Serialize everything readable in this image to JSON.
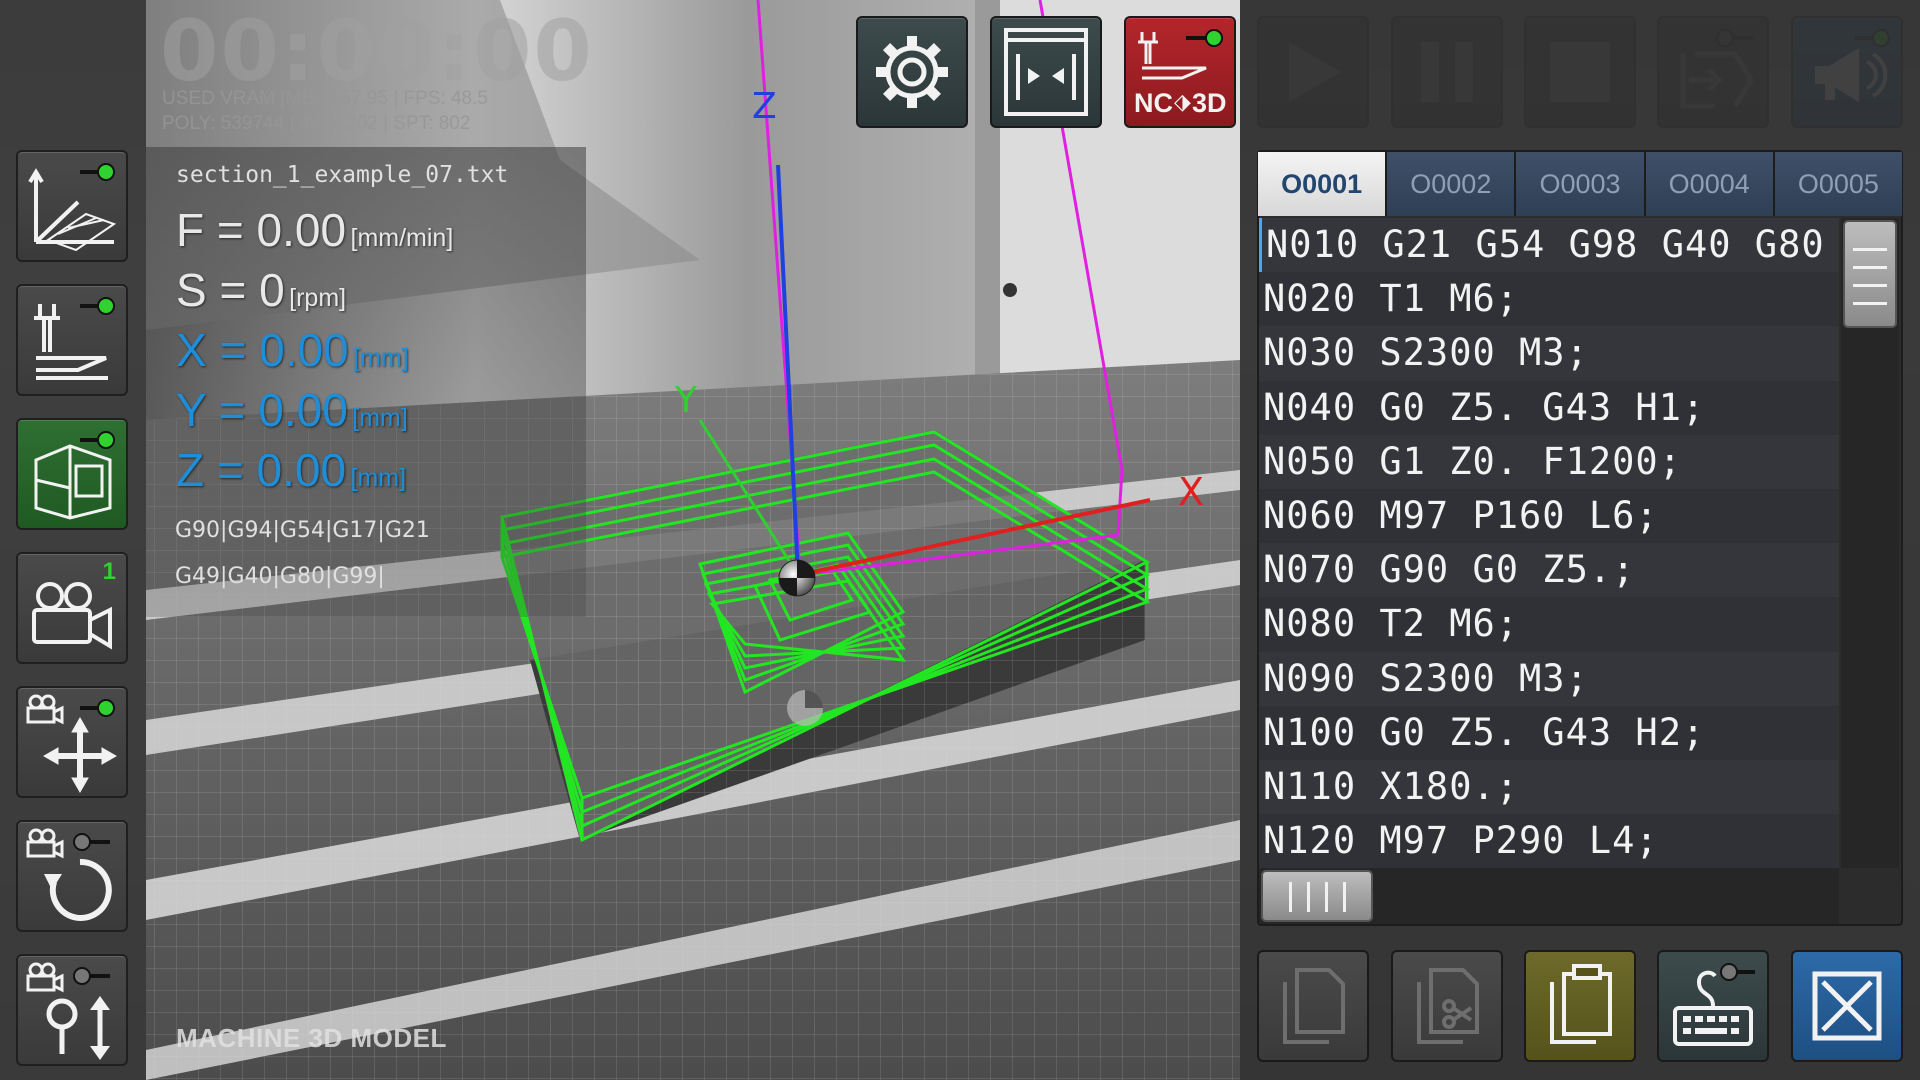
{
  "app": {
    "timer": "00:00:00",
    "stats_line1": "USED VRAM [MB]: 157.95 | FPS: 48.5",
    "stats_line2": "POLY: 539744 | IMG: 202 | SPT: 802"
  },
  "left_toolbar": {
    "items": [
      {
        "icon": "graph-grid-icon",
        "toggle": "on"
      },
      {
        "icon": "toolpath-icon",
        "toggle": "on"
      },
      {
        "icon": "machine-model-icon",
        "toggle": "on",
        "active": true
      },
      {
        "icon": "camera-icon",
        "badge": "1"
      },
      {
        "icon": "camera-pan-icon",
        "toggle": "on"
      },
      {
        "icon": "camera-rotate-icon",
        "toggle": "off"
      },
      {
        "icon": "camera-zoom-icon",
        "toggle": "off"
      }
    ]
  },
  "top_toolbar": {
    "settings_icon": "gear-icon",
    "split_icon": "split-view-icon",
    "nc3d_label": "NC",
    "nc3d_label2": "3D",
    "play_icon": "play-icon",
    "pause_icon": "pause-icon",
    "stop_icon": "stop-icon",
    "step_icon": "single-block-icon",
    "sound_icon": "megaphone-icon"
  },
  "hud": {
    "filename": "section_1_example_07.txt",
    "feed_label": "F = 0.00",
    "feed_unit": "[mm/min]",
    "spindle_label": "S = 0",
    "spindle_unit": "[rpm]",
    "x_label": "X = 0.00",
    "x_unit": "[mm]",
    "y_label": "Y = 0.00",
    "y_unit": "[mm]",
    "z_label": "Z = 0.00",
    "z_unit": "[mm]",
    "modal_line1": "G90|G94|G54|G17|G21",
    "modal_line2": "G49|G40|G80|G99|",
    "view_label": "MACHINE 3D MODEL"
  },
  "axes": {
    "x_label": "X",
    "y_label": "Y",
    "z_label": "Z"
  },
  "editor": {
    "tabs": [
      "O0001",
      "O0002",
      "O0003",
      "O0004",
      "O0005"
    ],
    "active_tab": 0,
    "lines": [
      "N010 G21 G54 G98 G40 G80",
      "N020 T1 M6;",
      "N030 S2300 M3;",
      "N040 G0 Z5. G43 H1;",
      "N050 G1 Z0. F1200;",
      "N060 M97 P160 L6;",
      "N070 G90 G0 Z5.;",
      "N080 T2 M6;",
      "N090 S2300 M3;",
      "N100 G0 Z5. G43 H2;",
      "N110 X180.;",
      "N120 M97 P290 L4;"
    ]
  },
  "bottom_toolbar": {
    "new_icon": "new-file-icon",
    "cut_icon": "cut-file-icon",
    "paste_icon": "paste-icon",
    "keyboard_icon": "keyboard-icon",
    "close_icon": "close-icon"
  },
  "colors": {
    "accent_blue": "#1f8ed9",
    "toolpath_green": "#22e622",
    "axis_red": "#e02020",
    "axis_blue": "#2040e0",
    "axis_green": "#30d030",
    "tool_magenta": "#e020e0"
  }
}
